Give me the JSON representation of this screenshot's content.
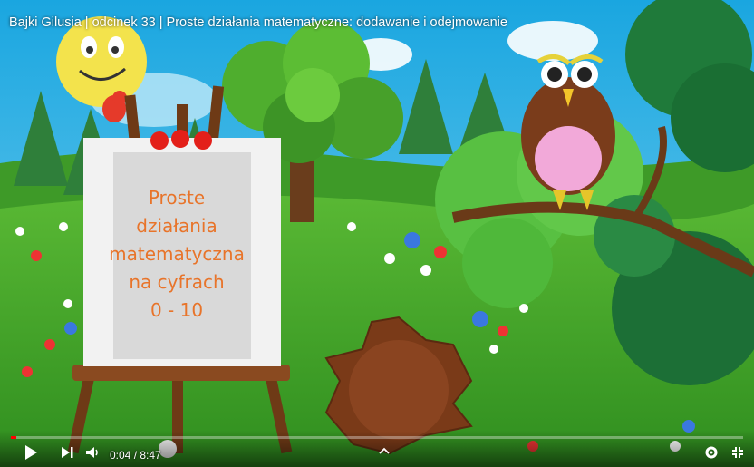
{
  "video": {
    "title": "Bajki Gilusia | odcinek 33 | Proste działania matematyczne: dodawanie i odejmowanie",
    "board_lines": [
      "Proste",
      "działania",
      "matematyczna",
      "na cyfrach",
      "0 - 10"
    ]
  },
  "controls": {
    "time_display": "0:04 / 8:47",
    "progress_fraction": 0.008,
    "icons": [
      "play-icon",
      "next-icon",
      "volume-icon",
      "chevron-up-icon",
      "settings-icon",
      "fullscreen-exit-icon"
    ]
  },
  "colors": {
    "progress": "#ff0000",
    "board_text": "#e8742a"
  }
}
